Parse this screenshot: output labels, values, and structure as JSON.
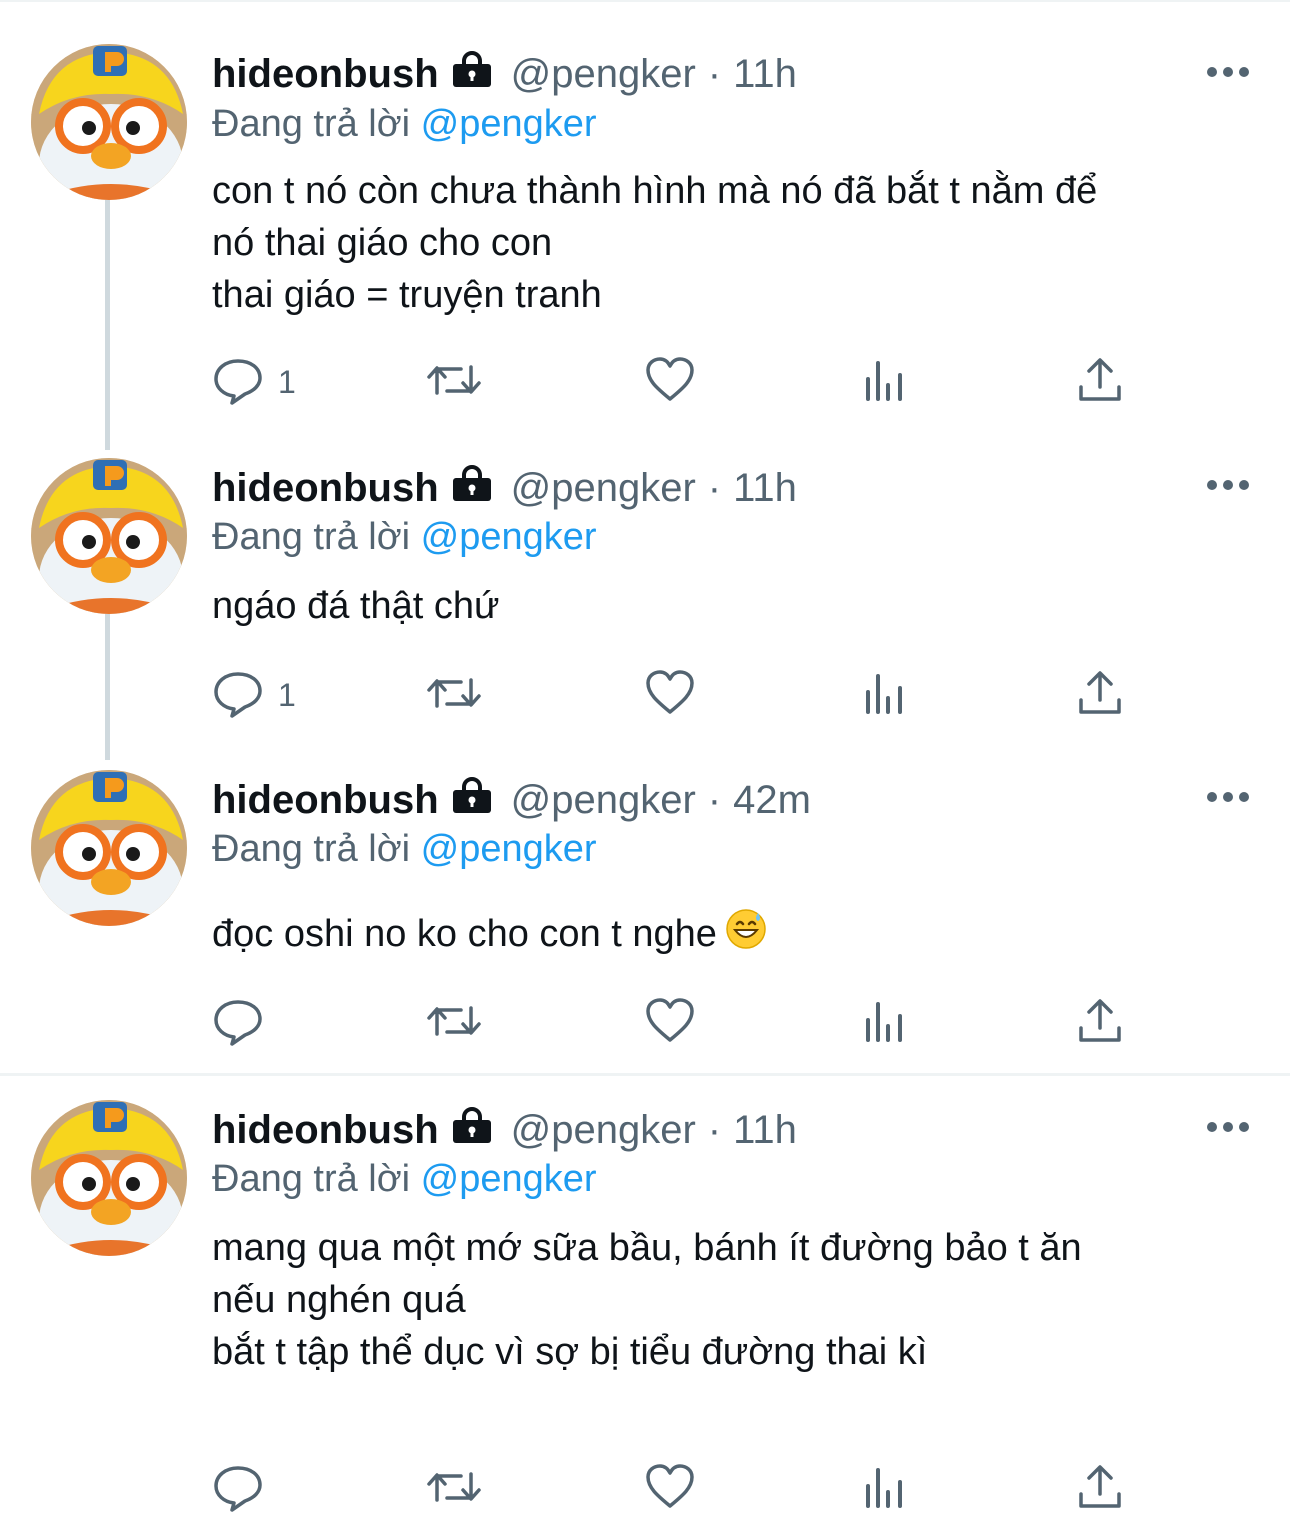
{
  "tweets": [
    {
      "name": "hideonbush",
      "handle": "@pengker",
      "separator": "·",
      "time": "11h",
      "replying_prefix": "Đang trả lời",
      "replying_to": "@pengker",
      "body_lines": [
        "con t nó còn chưa thành hình mà nó đã bắt t nằm để",
        "nó thai giáo cho con",
        "thai giáo = truyện tranh"
      ],
      "reply_count": "1"
    },
    {
      "name": "hideonbush",
      "handle": "@pengker",
      "separator": "·",
      "time": "11h",
      "replying_prefix": "Đang trả lời",
      "replying_to": "@pengker",
      "body_lines": [
        "ngáo đá thật chứ"
      ],
      "reply_count": "1"
    },
    {
      "name": "hideonbush",
      "handle": "@pengker",
      "separator": "·",
      "time": "42m",
      "replying_prefix": "Đang trả lời",
      "replying_to": "@pengker",
      "body_lines": [
        "đọc oshi no ko cho con t nghe"
      ],
      "body_emoji": "grinning-sweat-emoji",
      "reply_count": ""
    },
    {
      "name": "hideonbush",
      "handle": "@pengker",
      "separator": "·",
      "time": "11h",
      "replying_prefix": "Đang trả lời",
      "replying_to": "@pengker",
      "body_lines": [
        "mang qua một mớ sữa bầu, bánh ít đường bảo t ăn",
        "nếu nghén quá",
        "bắt t tập thể dục vì sợ bị tiểu đường thai kì"
      ],
      "reply_count": ""
    }
  ],
  "icons": {
    "lock": "lock-icon",
    "more": "more-icon",
    "reply": "reply-icon",
    "retweet": "retweet-icon",
    "like": "like-icon",
    "views": "views-icon",
    "share": "share-icon"
  },
  "colors": {
    "text": "#0f1419",
    "secondary": "#536471",
    "link": "#1d9bf0",
    "thread_line": "#cfd9de",
    "divider": "#eff3f4"
  }
}
